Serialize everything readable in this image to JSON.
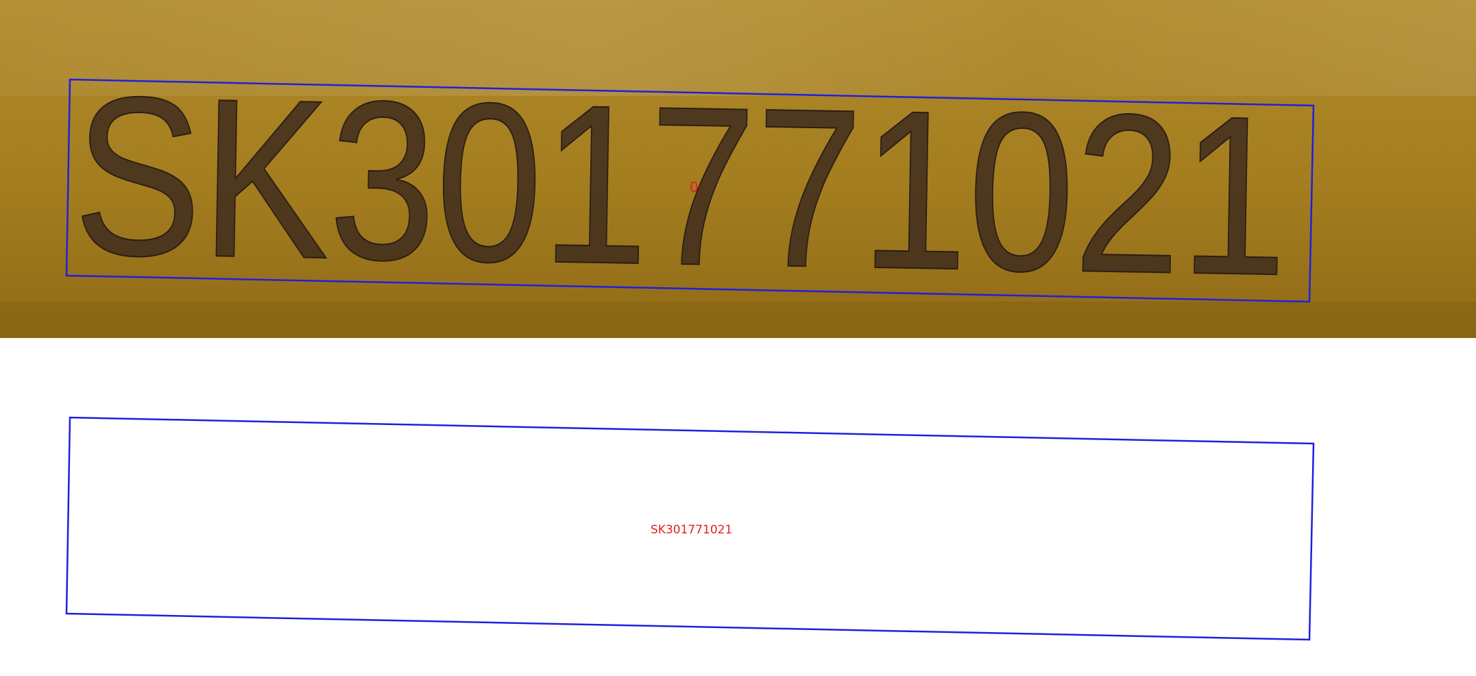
{
  "photo": {
    "handwritten_text": "SK301771021",
    "region_index_label": "0"
  },
  "rendering": {
    "recognized_text": "SK301771021"
  },
  "colors": {
    "surface_top": "#b08a2b",
    "surface_mid": "#a47d1f",
    "surface_bottom": "#8f6b16",
    "ink": "#3b2a1e",
    "box_stroke": "#1f1fe0",
    "label_color": "#e02020",
    "background": "#ffffff"
  }
}
